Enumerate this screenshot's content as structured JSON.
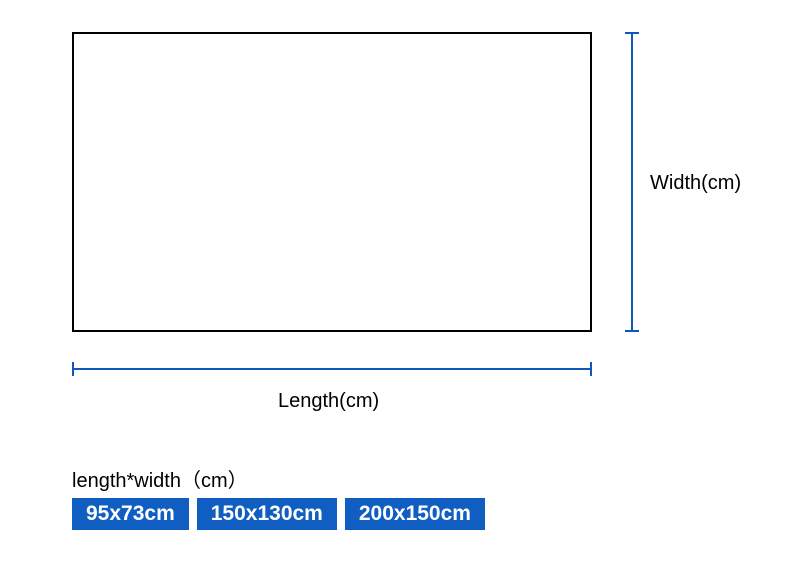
{
  "diagram": {
    "width_label": "Width(cm)",
    "length_label": "Length(cm)"
  },
  "options": {
    "title": "length*width（cm）",
    "sizes": [
      {
        "label": "95x73cm"
      },
      {
        "label": "150x130cm"
      },
      {
        "label": "200x150cm"
      }
    ]
  },
  "colors": {
    "accent": "#115ec2",
    "bracket": "#1159b8",
    "text": "#000000"
  }
}
